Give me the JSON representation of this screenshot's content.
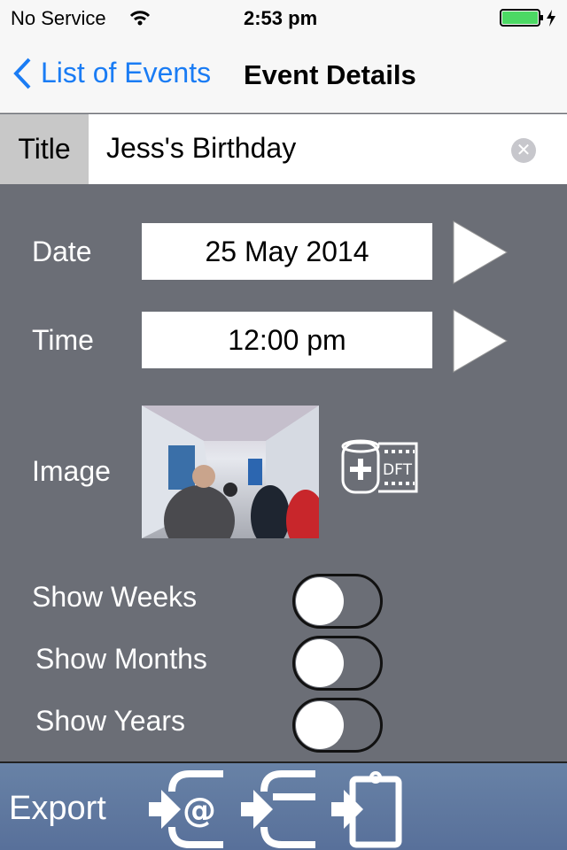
{
  "status": {
    "carrier": "No Service",
    "time": "2:53 pm",
    "battery_level": 1.0
  },
  "nav": {
    "back_label": "List of Events",
    "title": "Event Details"
  },
  "title": {
    "label": "Title",
    "value": "Jess's Birthday"
  },
  "date": {
    "label": "Date",
    "value": "25 May 2014"
  },
  "time": {
    "label": "Time",
    "value": "12:00 pm"
  },
  "image": {
    "label": "Image",
    "add_icon_text": "DFT"
  },
  "toggles": [
    {
      "label": "Show Weeks",
      "on": false
    },
    {
      "label": "Show Months",
      "on": false
    },
    {
      "label": "Show Years",
      "on": false
    }
  ],
  "toolbar": {
    "export_label": "Export"
  },
  "colors": {
    "accent": "#1a7cf4",
    "background": "#6b6e76",
    "toolbar": "#607aa0",
    "battery": "#4cd964"
  }
}
